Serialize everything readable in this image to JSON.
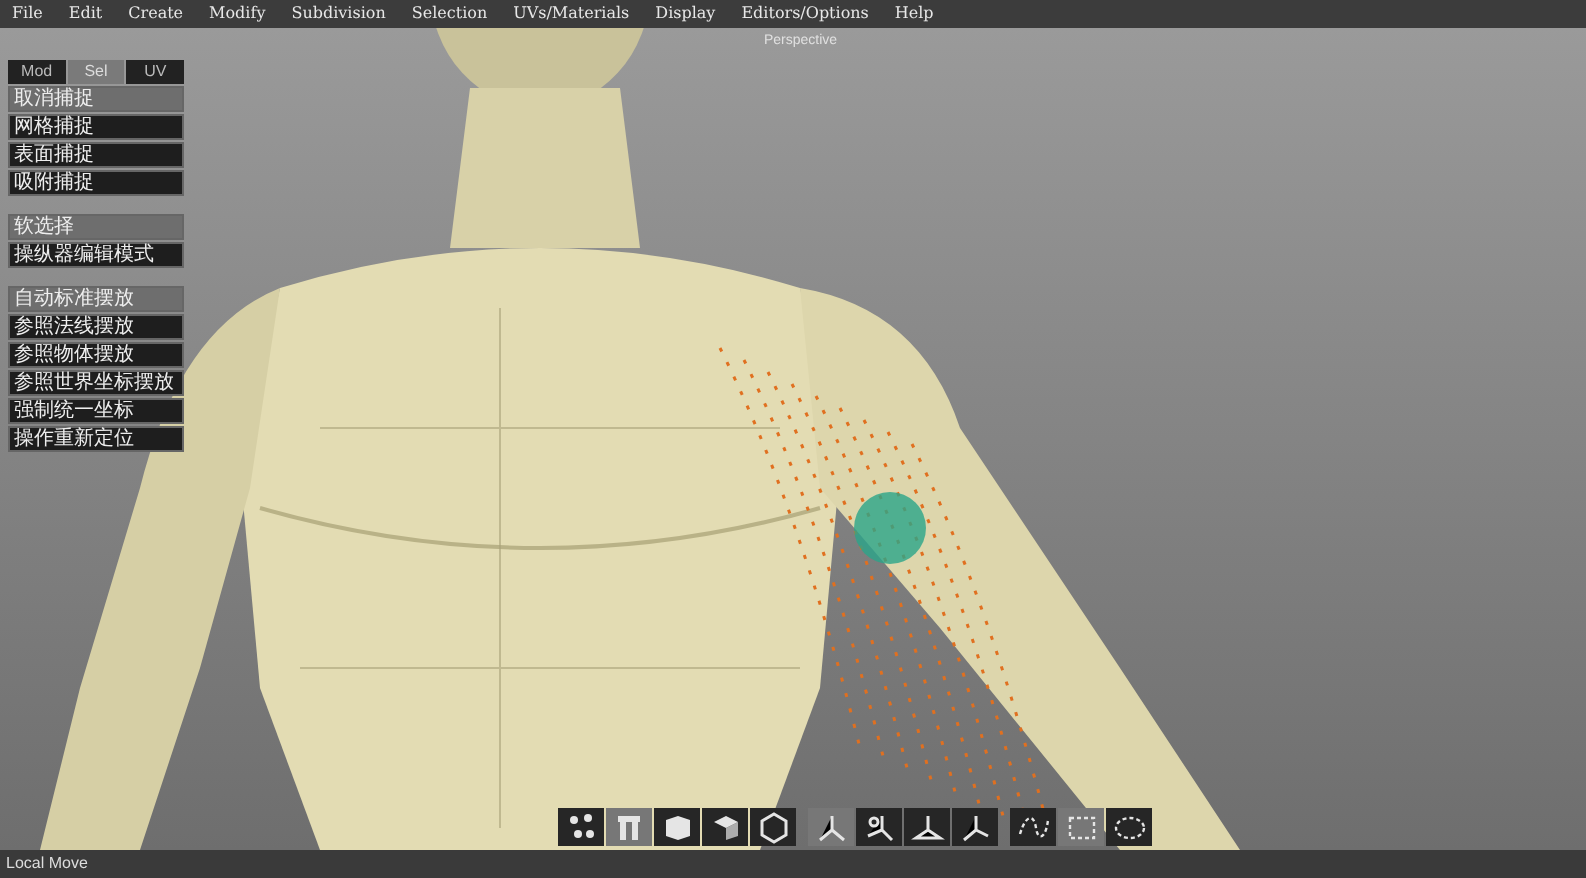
{
  "menu": [
    "File",
    "Edit",
    "Create",
    "Modify",
    "Subdivision",
    "Selection",
    "UVs/Materials",
    "Display",
    "Editors/Options",
    "Help"
  ],
  "viewport": {
    "label": "Perspective"
  },
  "panel": {
    "tabs": [
      {
        "label": "Mod",
        "selected": false
      },
      {
        "label": "Sel",
        "selected": true
      },
      {
        "label": "UV",
        "selected": false
      }
    ],
    "groups": [
      [
        {
          "label": "取消捕捉",
          "selected": true
        },
        {
          "label": "网格捕捉",
          "selected": false
        },
        {
          "label": "表面捕捉",
          "selected": false
        },
        {
          "label": "吸附捕捉",
          "selected": false
        }
      ],
      [
        {
          "label": "软选择",
          "selected": true
        },
        {
          "label": "操纵器编辑模式",
          "selected": false
        }
      ],
      [
        {
          "label": "自动标准摆放",
          "selected": true
        },
        {
          "label": "参照法线摆放",
          "selected": false
        },
        {
          "label": "参照物体摆放",
          "selected": false
        },
        {
          "label": "参照世界坐标摆放",
          "selected": false
        },
        {
          "label": "强制统一坐标",
          "selected": false
        },
        {
          "label": "操作重新定位",
          "selected": false
        }
      ]
    ]
  },
  "toolbar": [
    [
      {
        "kind": "vertices",
        "selected": false
      },
      {
        "kind": "edges",
        "selected": true
      },
      {
        "kind": "faces",
        "selected": false
      },
      {
        "kind": "object",
        "selected": false
      },
      {
        "kind": "hexagon",
        "selected": false
      }
    ],
    [
      {
        "kind": "axis",
        "selected": true
      },
      {
        "kind": "axis-rotate",
        "selected": false
      },
      {
        "kind": "axis-world",
        "selected": false
      },
      {
        "kind": "axis-local",
        "selected": false
      }
    ],
    [
      {
        "kind": "curve",
        "selected": false
      },
      {
        "kind": "marquee",
        "selected": true
      },
      {
        "kind": "lasso",
        "selected": false
      }
    ]
  ],
  "status_bar": "Local Move"
}
